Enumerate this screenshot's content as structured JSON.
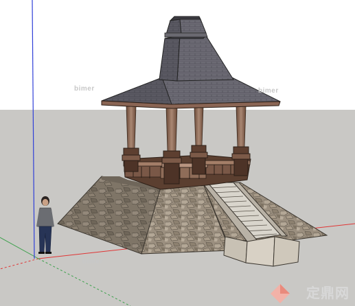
{
  "scene": {
    "sky_color": "#ffffff",
    "ground_color": "#c9c8c5",
    "axis_colors": {
      "red": "#e03434",
      "green": "#3aa04a",
      "blue": "#2f3fd8"
    }
  },
  "watermarks": {
    "label_1": "bimer",
    "label_2": "bimer",
    "label_3": "bimer"
  },
  "site_logo": {
    "text": "定鼎网",
    "icon": "diamond-logo-icon"
  }
}
